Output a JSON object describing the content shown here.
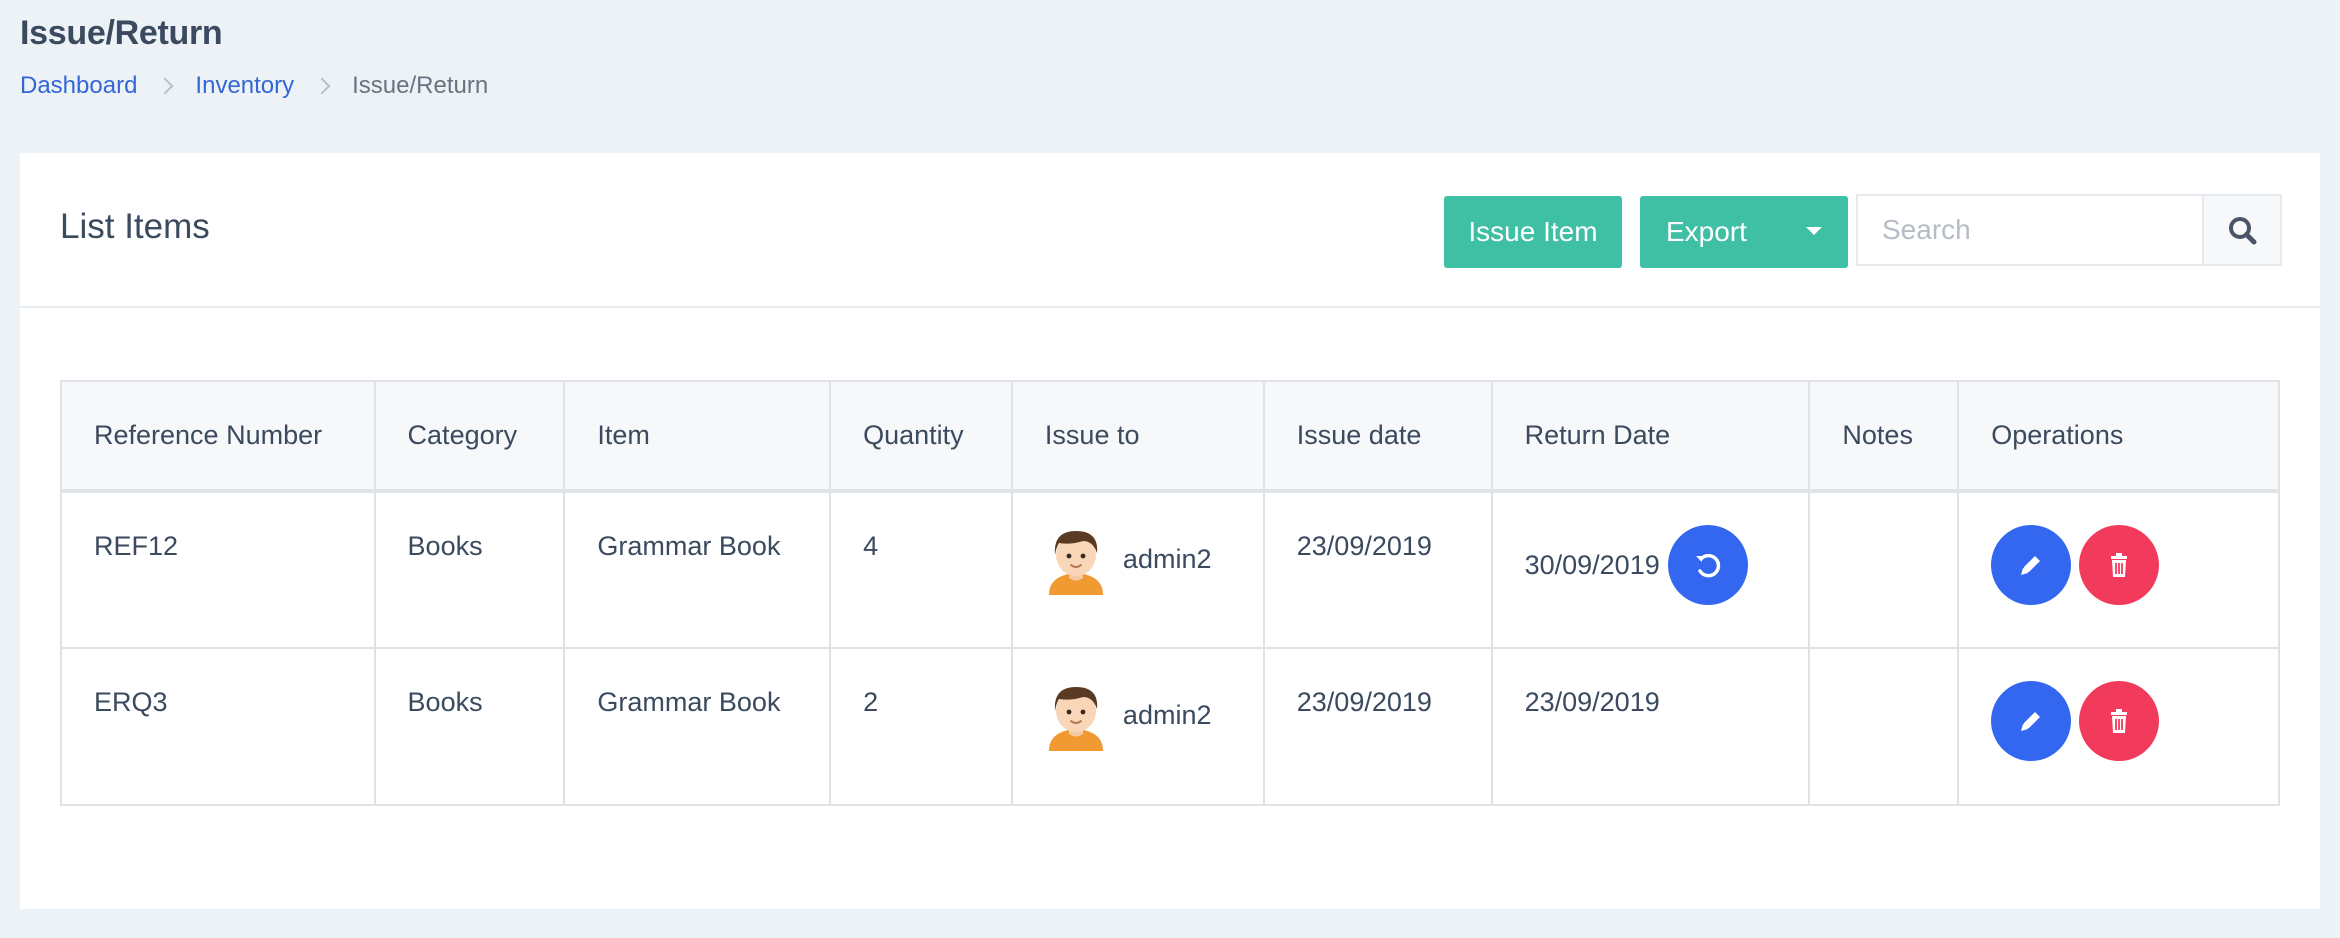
{
  "page": {
    "title": "Issue/Return",
    "breadcrumb": [
      "Dashboard",
      "Inventory",
      "Issue/Return"
    ]
  },
  "card": {
    "title": "List Items",
    "issue_button": "Issue Item",
    "export_button": "Export",
    "search_placeholder": "Search"
  },
  "table": {
    "headers": [
      "Reference Number",
      "Category",
      "Item",
      "Quantity",
      "Issue to",
      "Issue date",
      "Return Date",
      "Notes",
      "Operations"
    ],
    "rows": [
      {
        "ref": "REF12",
        "category": "Books",
        "item": "Grammar Book",
        "quantity": "4",
        "issue_to": "admin2",
        "issue_date": "23/09/2019",
        "return_date": "30/09/2019",
        "notes": ""
      },
      {
        "ref": "ERQ3",
        "category": "Books",
        "item": "Grammar Book",
        "quantity": "2",
        "issue_to": "admin2",
        "issue_date": "23/09/2019",
        "return_date": "23/09/2019",
        "notes": ""
      }
    ]
  },
  "icons": {
    "breadcrumb_sep": "chevron-right-icon",
    "export_caret": "caret-down-icon",
    "search": "search-icon",
    "return": "undo-icon",
    "edit": "pencil-icon",
    "delete": "trash-icon",
    "avatar": "user-avatar-icon"
  },
  "colors": {
    "background": "#edf2f6",
    "accent_green": "#3fbfa4",
    "primary_blue": "#3367f0",
    "danger_red": "#f23a5c",
    "link_blue": "#3367d6"
  }
}
